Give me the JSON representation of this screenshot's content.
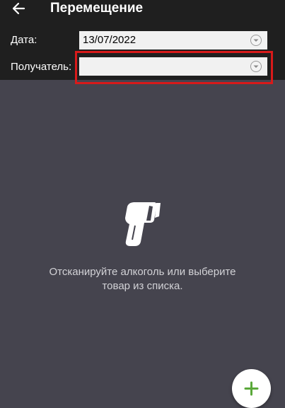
{
  "header": {
    "title": "Перемещение",
    "back_icon": "arrow-left-icon"
  },
  "form": {
    "date_label": "Дата:",
    "date_value": "13/07/2022",
    "recipient_label": "Получатель:",
    "recipient_value": ""
  },
  "empty_state": {
    "icon": "barcode-scanner-icon",
    "line1": "Отсканируйте алкоголь или выберите",
    "line2": "товар из списка."
  },
  "fab": {
    "icon": "plus-icon"
  },
  "colors": {
    "header_bg": "#1f1f1f",
    "body_bg": "#45444e",
    "highlight": "#d81a1a",
    "accent_green": "#5aa83a"
  }
}
